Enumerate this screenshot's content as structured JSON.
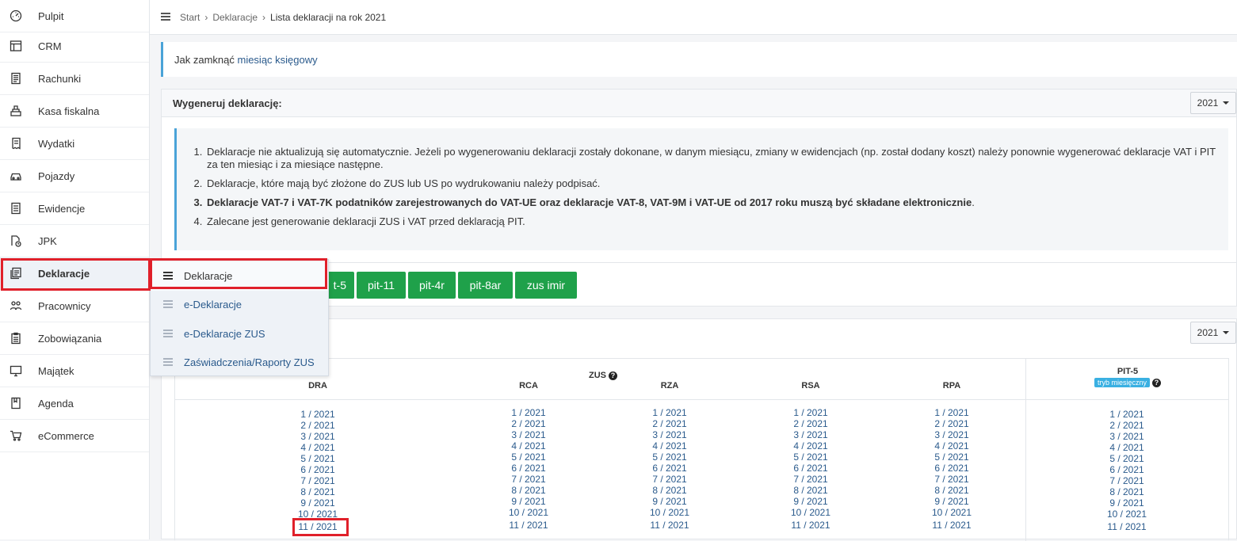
{
  "sidebar": {
    "items": [
      {
        "label": "Pulpit",
        "icon": "gauge-icon"
      },
      {
        "label": "CRM",
        "icon": "layout-icon"
      },
      {
        "label": "Rachunki",
        "icon": "invoice-icon"
      },
      {
        "label": "Kasa fiskalna",
        "icon": "cash-register-icon"
      },
      {
        "label": "Wydatki",
        "icon": "receipt-icon"
      },
      {
        "label": "Pojazdy",
        "icon": "car-icon"
      },
      {
        "label": "Ewidencje",
        "icon": "ledger-icon"
      },
      {
        "label": "JPK",
        "icon": "file-clock-icon"
      },
      {
        "label": "Deklaracje",
        "icon": "declaration-icon"
      },
      {
        "label": "Pracownicy",
        "icon": "people-icon"
      },
      {
        "label": "Zobowiązania",
        "icon": "clipboard-icon"
      },
      {
        "label": "Majątek",
        "icon": "monitor-icon"
      },
      {
        "label": "Agenda",
        "icon": "book-icon"
      },
      {
        "label": "eCommerce",
        "icon": "cart-icon"
      }
    ]
  },
  "breadcrumb": {
    "items": [
      "Start",
      "Deklaracje",
      "Lista deklaracji na rok 2021"
    ]
  },
  "info": {
    "text": "Jak zamknąć ",
    "link": "miesiąc księgowy"
  },
  "generate": {
    "title": "Wygeneruj deklarację:",
    "year": "2021",
    "notes": [
      "Deklaracje nie aktualizują się automatycznie. Jeżeli po wygenerowaniu deklaracji zostały dokonane, w danym miesiącu, zmiany w ewidencjach (np. został dodany koszt) należy ponownie wygenerować deklaracje VAT i PIT za ten miesiąc i za miesiące następne.",
      "Deklaracje, które mają być złożone do ZUS lub US po wydrukowaniu należy podpisać.",
      "Deklaracje VAT-7 i VAT-7K podatników zarejestrowanych do VAT-UE oraz deklaracje VAT-8, VAT-9M i VAT-UE od 2017 roku muszą być składane elektronicznie",
      "Zalecane jest generowanie deklaracji ZUS i VAT przed deklaracją PIT."
    ],
    "note3_tail": ".",
    "buttons": [
      "t-5",
      "pit-11",
      "pit-4r",
      "pit-8ar",
      "zus imir"
    ]
  },
  "list": {
    "year": "2021",
    "zus_label": "ZUS",
    "columns": [
      "DRA",
      "RCA",
      "RZA",
      "RSA",
      "RPA"
    ],
    "pit_label": "PIT-5",
    "pit_badge": "tryb miesięczny",
    "months": [
      "1 / 2021",
      "2 / 2021",
      "3 / 2021",
      "4 / 2021",
      "5 / 2021",
      "6 / 2021",
      "7 / 2021",
      "8 / 2021",
      "9 / 2021",
      "10 / 2021",
      "11 / 2021"
    ]
  },
  "submenu": {
    "items": [
      "Deklaracje",
      "e-Deklaracje",
      "e-Deklaracje ZUS",
      "Zaświadczenia/Raporty ZUS"
    ]
  },
  "colors": {
    "accent_green": "#1fa14a",
    "highlight_red": "#e0202a",
    "info_blue": "#4aa3d8"
  }
}
